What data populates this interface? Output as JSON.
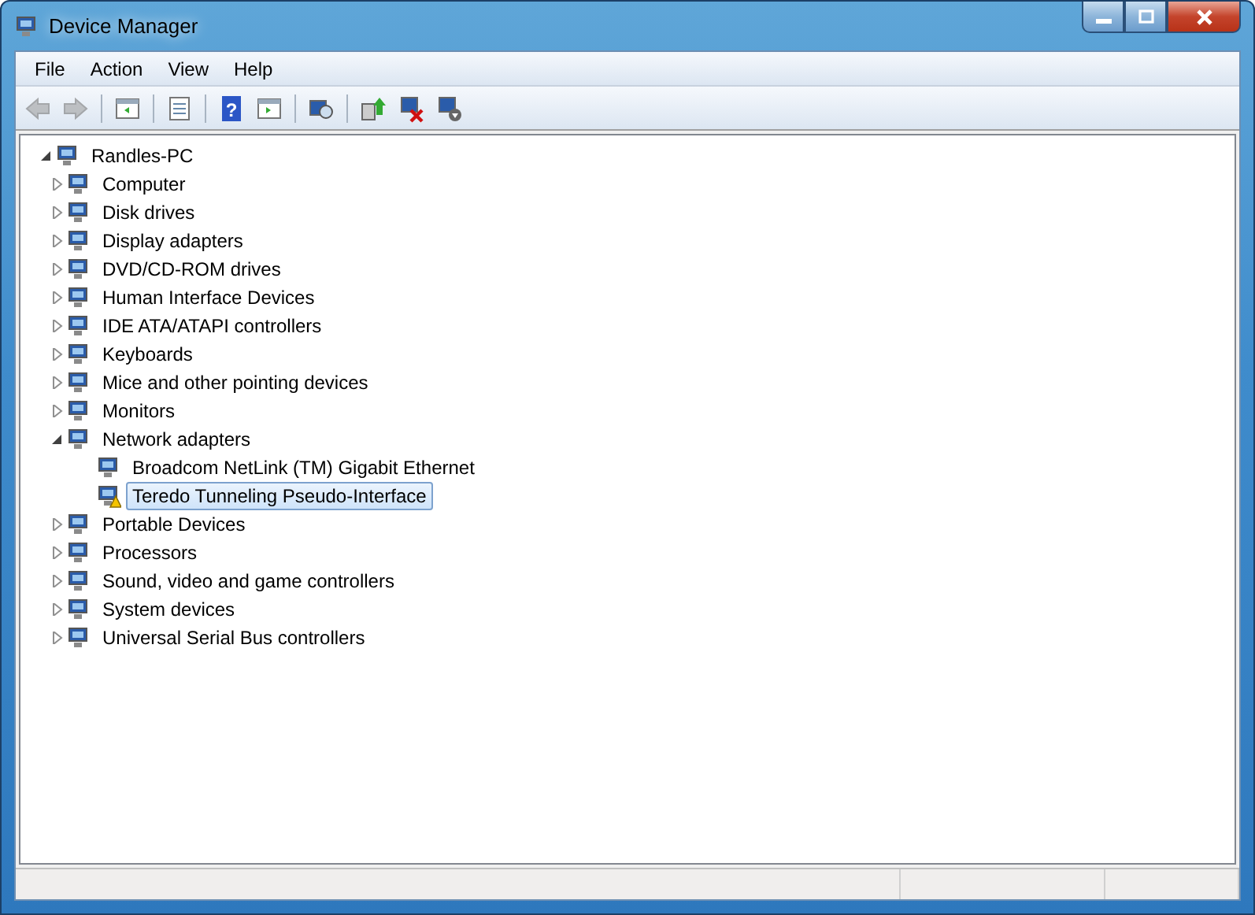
{
  "window": {
    "title": "Device Manager",
    "controls": [
      {
        "kind": "minimize"
      },
      {
        "kind": "maximize"
      },
      {
        "kind": "close"
      }
    ]
  },
  "menu": [
    "File",
    "Action",
    "View",
    "Help"
  ],
  "toolbar": [
    {
      "kind": "back",
      "disabled": true
    },
    {
      "kind": "forward",
      "disabled": true
    },
    {
      "kind": "sep"
    },
    {
      "kind": "console"
    },
    {
      "kind": "sep"
    },
    {
      "kind": "properties"
    },
    {
      "kind": "sep"
    },
    {
      "kind": "help",
      "glyph": "?"
    },
    {
      "kind": "action"
    },
    {
      "kind": "sep"
    },
    {
      "kind": "scan"
    },
    {
      "kind": "sep"
    },
    {
      "kind": "update"
    },
    {
      "kind": "uninstall"
    },
    {
      "kind": "disable"
    }
  ],
  "tree": {
    "label": "Randles-PC",
    "expanded": true,
    "children": [
      {
        "label": "Computer",
        "expanded": false
      },
      {
        "label": "Disk drives",
        "expanded": false
      },
      {
        "label": "Display adapters",
        "expanded": false
      },
      {
        "label": "DVD/CD-ROM drives",
        "expanded": false
      },
      {
        "label": "Human Interface Devices",
        "expanded": false
      },
      {
        "label": "IDE ATA/ATAPI controllers",
        "expanded": false
      },
      {
        "label": "Keyboards",
        "expanded": false
      },
      {
        "label": "Mice and other pointing devices",
        "expanded": false
      },
      {
        "label": "Monitors",
        "expanded": false
      },
      {
        "label": "Network adapters",
        "expanded": true,
        "children": [
          {
            "label": "Broadcom NetLink (TM) Gigabit Ethernet",
            "selected": false,
            "warning": false
          },
          {
            "label": "Teredo Tunneling Pseudo-Interface",
            "selected": true,
            "warning": true
          }
        ]
      },
      {
        "label": "Portable Devices",
        "expanded": false
      },
      {
        "label": "Processors",
        "expanded": false
      },
      {
        "label": "Sound, video and game controllers",
        "expanded": false
      },
      {
        "label": "System devices",
        "expanded": false
      },
      {
        "label": "Universal Serial Bus controllers",
        "expanded": false
      }
    ]
  }
}
